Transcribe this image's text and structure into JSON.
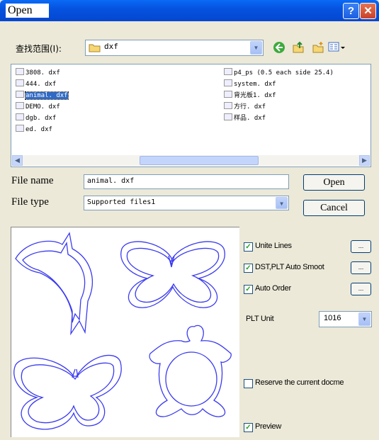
{
  "window": {
    "title": "Open"
  },
  "lookin": {
    "label": "查找范围(I):",
    "folder": "dxf"
  },
  "files": {
    "col1": [
      "3808. dxf",
      "444. dxf",
      "animal. dxf",
      "DEMO. dxf",
      "dgb. dxf",
      "ed. dxf"
    ],
    "col2": [
      "p4_ps (0.5 each side 25.4)",
      "system. dxf",
      "背光板1. dxf",
      "方行. dxf",
      "样品. dxf"
    ],
    "selected": "animal. dxf"
  },
  "filename": {
    "label": "File name",
    "value": "animal. dxf"
  },
  "filetype": {
    "label": "File type",
    "value": "Supported files1"
  },
  "buttons": {
    "open": "Open",
    "cancel": "Cancel",
    "more": "..."
  },
  "options": {
    "unite_lines": "Unite Lines",
    "auto_smooth": "DST,PLT Auto Smoot",
    "auto_order": "Auto Order",
    "plt_unit_label": "PLT Unit",
    "plt_unit_value": "1016",
    "reserve": "Reserve the current docme",
    "preview": "Preview",
    "unite_lines_checked": true,
    "auto_smooth_checked": true,
    "auto_order_checked": true,
    "reserve_checked": false,
    "preview_checked": true
  },
  "colors": {
    "titlebar": "#0553E0",
    "dialog": "#ECE9D8",
    "selection": "#316AC5",
    "shape_stroke": "#3B3BF0"
  },
  "preview_shapes": [
    "dolphin",
    "butterfly",
    "butterfly",
    "turtle"
  ]
}
